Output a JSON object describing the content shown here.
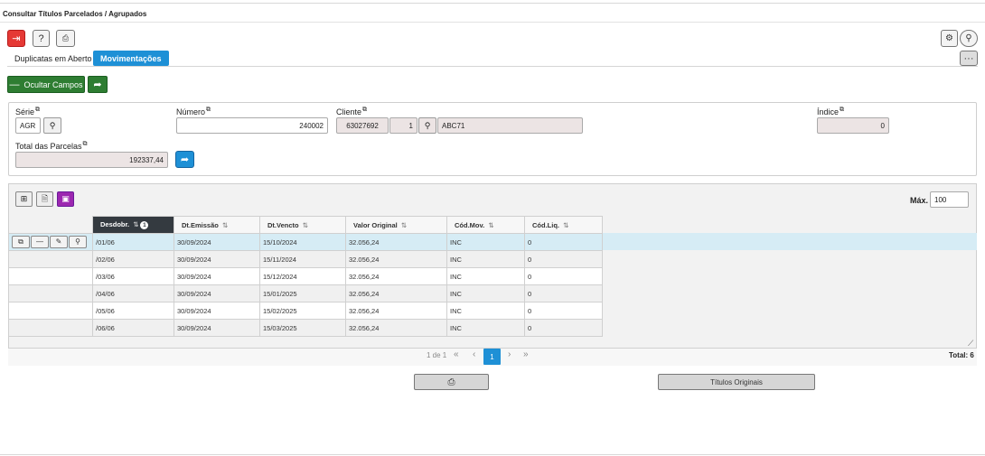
{
  "page": {
    "title": "Consultar Títulos Parcelados / Agrupados"
  },
  "tabs": [
    {
      "label": "Duplicatas em Aberto",
      "active": false
    },
    {
      "label": "Movimentações",
      "active": true
    }
  ],
  "actions": {
    "hide_fields_label": "Ocultar Campos"
  },
  "form": {
    "serie": {
      "label": "Série",
      "value": "AGR"
    },
    "numero": {
      "label": "Número",
      "value": "240002"
    },
    "cliente": {
      "label": "Cliente",
      "code": "63027692",
      "seq": "1",
      "name": "ABC71"
    },
    "indice": {
      "label": "Índice",
      "value": "0"
    },
    "total_parcelas": {
      "label": "Total das Parcelas",
      "value": "192337,44"
    }
  },
  "grid": {
    "max_label": "Máx.",
    "max_value": "100",
    "sort_badge": "1",
    "columns": [
      "Desdobr.",
      "Dt.Emissão",
      "Dt.Vencto",
      "Valor Original",
      "Cód.Mov.",
      "Cód.Liq."
    ],
    "rows": [
      [
        "/01/06",
        "30/09/2024",
        "15/10/2024",
        "32.056,24",
        "INC",
        "0"
      ],
      [
        "/02/06",
        "30/09/2024",
        "15/11/2024",
        "32.056,24",
        "INC",
        "0"
      ],
      [
        "/03/06",
        "30/09/2024",
        "15/12/2024",
        "32.056,24",
        "INC",
        "0"
      ],
      [
        "/04/06",
        "30/09/2024",
        "15/01/2025",
        "32.056,24",
        "INC",
        "0"
      ],
      [
        "/05/06",
        "30/09/2024",
        "15/02/2025",
        "32.056,24",
        "INC",
        "0"
      ],
      [
        "/06/06",
        "30/09/2024",
        "15/03/2025",
        "32.056,24",
        "INC",
        "0"
      ]
    ],
    "pager": {
      "info": "1 de 1",
      "first": "«",
      "prev": "‹",
      "current": "1",
      "next": "›",
      "last": "»"
    },
    "total": "Total: 6"
  },
  "footer": {
    "original_titles_label": "Títulos Originais"
  },
  "colors": {
    "accent": "#1e90d6",
    "green": "#2e7d32",
    "red": "#e53935",
    "purple": "#9c27b0",
    "selected_row": "#d6ecf5"
  },
  "icons": [
    "exit-icon",
    "help-icon",
    "print-icon",
    "gear-icon",
    "search-icon",
    "more-icon",
    "minus-icon",
    "share-arrow-icon",
    "copy-icon",
    "edit-icon",
    "grid-layout-icon",
    "export-icon",
    "image-icon",
    "resize-icon"
  ]
}
